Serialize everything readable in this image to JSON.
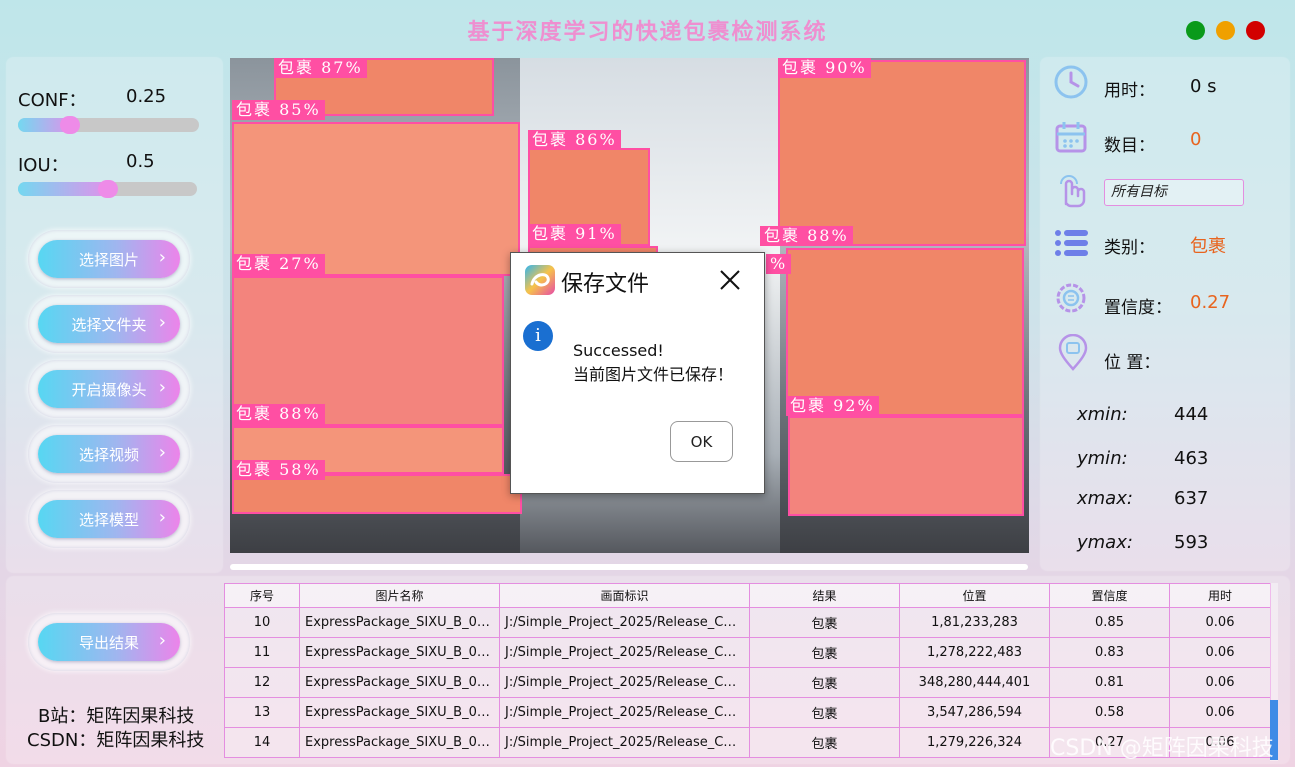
{
  "app": {
    "title": "基于深度学习的快递包裹检测系统",
    "window_dots": [
      "#0a9a1a",
      "#f0a000",
      "#d20000"
    ]
  },
  "params": {
    "conf_label": "CONF：",
    "conf_value": "0.25",
    "conf_level": 0.25,
    "iou_label": "IOU：",
    "iou_value": "0.5",
    "iou_level": 0.5
  },
  "buttons": {
    "select_image": "选择图片",
    "select_folder": "选择文件夹",
    "open_camera": "开启摄像头",
    "select_video": "选择视频",
    "select_model": "选择模型",
    "export": "导出结果",
    "chevron": "›"
  },
  "detections": [
    {
      "label": "包裹 87%"
    },
    {
      "label": "包裹 85%"
    },
    {
      "label": "包裹 86%"
    },
    {
      "label": "包裹 90%"
    },
    {
      "label": "包裹 91%"
    },
    {
      "label": "包裹 88%"
    },
    {
      "label": "包裹 27%"
    },
    {
      "label": "包裹 88%"
    },
    {
      "label": "包裹 58%"
    },
    {
      "label": "包裹 92%"
    },
    {
      "label": "%"
    }
  ],
  "info": {
    "time_label": "用时：",
    "time_value": "0 s",
    "count_label": "数目：",
    "count_value": "0",
    "target_select": "所有目标",
    "class_label": "类别：",
    "class_value": "包裹",
    "conf_label": "置信度：",
    "conf_value": "0.27",
    "pos_label": "位 置：",
    "xmin_label": "xmin:",
    "xmin": "444",
    "ymin_label": "ymin:",
    "ymin": "463",
    "xmax_label": "xmax:",
    "xmax": "637",
    "ymax_label": "ymax:",
    "ymax": "593",
    "accent": "#e8641e"
  },
  "table": {
    "headers": [
      "序号",
      "图片名称",
      "画面标识",
      "结果",
      "位置",
      "置信度",
      "用时"
    ],
    "rows": [
      [
        "10",
        "ExpressPackage_SIXU_B_005...",
        "J:/Simple_Project_2025/Release_Code...",
        "包裹",
        "1,81,233,283",
        "0.85",
        "0.06"
      ],
      [
        "11",
        "ExpressPackage_SIXU_B_005...",
        "J:/Simple_Project_2025/Release_Code...",
        "包裹",
        "1,278,222,483",
        "0.83",
        "0.06"
      ],
      [
        "12",
        "ExpressPackage_SIXU_B_005...",
        "J:/Simple_Project_2025/Release_Code...",
        "包裹",
        "348,280,444,401",
        "0.81",
        "0.06"
      ],
      [
        "13",
        "ExpressPackage_SIXU_B_005...",
        "J:/Simple_Project_2025/Release_Code...",
        "包裹",
        "3,547,286,594",
        "0.58",
        "0.06"
      ],
      [
        "14",
        "ExpressPackage_SIXU_B_005...",
        "J:/Simple_Project_2025/Release_Code...",
        "包裹",
        "1,279,226,324",
        "0.27",
        "0.06"
      ]
    ]
  },
  "dialog": {
    "title": "保存文件",
    "info_glyph": "i",
    "line1": "Successed!",
    "line2": "当前图片文件已保存！",
    "ok": "OK"
  },
  "credits": {
    "bilibili": "B站：矩阵因果科技",
    "csdn": "CSDN：矩阵因果科技"
  },
  "watermark": "CSDN @矩阵因果科技"
}
